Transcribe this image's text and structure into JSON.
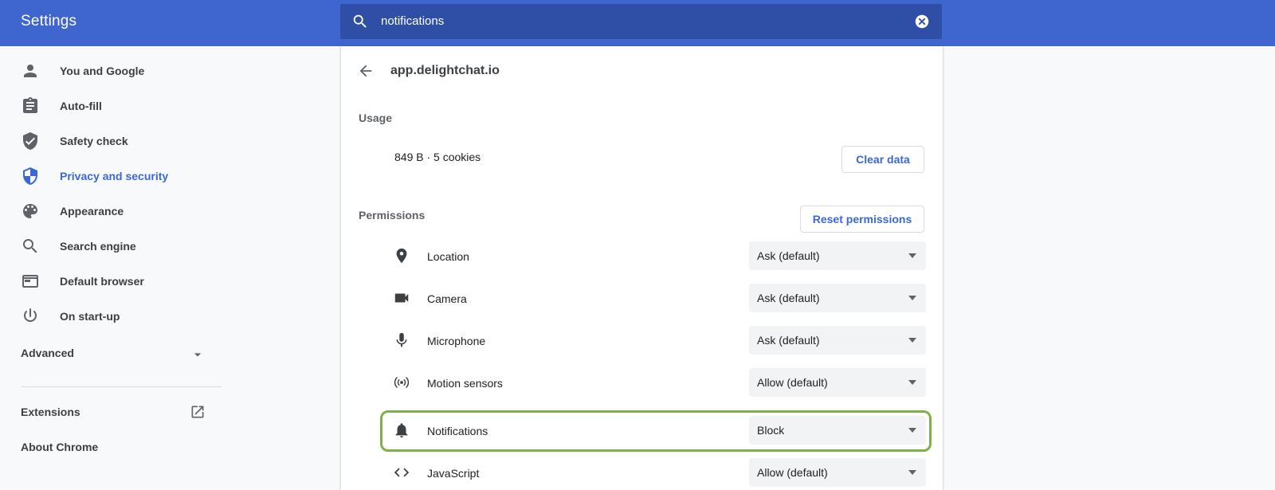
{
  "header": {
    "title": "Settings",
    "search_value": "notifications",
    "accent_color": "#3f66cf"
  },
  "sidebar": {
    "items": [
      {
        "label": "You and Google",
        "icon": "person-icon"
      },
      {
        "label": "Auto-fill",
        "icon": "clipboard-icon"
      },
      {
        "label": "Safety check",
        "icon": "shield-check-icon"
      },
      {
        "label": "Privacy and security",
        "icon": "shield-icon",
        "active": true
      },
      {
        "label": "Appearance",
        "icon": "palette-icon"
      },
      {
        "label": "Search engine",
        "icon": "search-icon"
      },
      {
        "label": "Default browser",
        "icon": "browser-icon"
      },
      {
        "label": "On start-up",
        "icon": "power-icon"
      }
    ],
    "advanced_label": "Advanced",
    "extensions_label": "Extensions",
    "about_label": "About Chrome",
    "active_color": "#3a68d4"
  },
  "site": {
    "title": "app.delightchat.io",
    "usage_heading": "Usage",
    "usage_text": "849 B · 5 cookies",
    "clear_data_label": "Clear data",
    "permissions_heading": "Permissions",
    "reset_permissions_label": "Reset permissions",
    "permissions": [
      {
        "label": "Location",
        "value": "Ask (default)",
        "icon": "location-pin-icon"
      },
      {
        "label": "Camera",
        "value": "Ask (default)",
        "icon": "camera-icon"
      },
      {
        "label": "Microphone",
        "value": "Ask (default)",
        "icon": "microphone-icon"
      },
      {
        "label": "Motion sensors",
        "value": "Allow (default)",
        "icon": "motion-sensor-icon"
      },
      {
        "label": "Notifications",
        "value": "Block",
        "icon": "bell-icon",
        "highlighted": true
      },
      {
        "label": "JavaScript",
        "value": "Allow (default)",
        "icon": "code-icon"
      }
    ],
    "highlight_color": "#7fb14b"
  }
}
